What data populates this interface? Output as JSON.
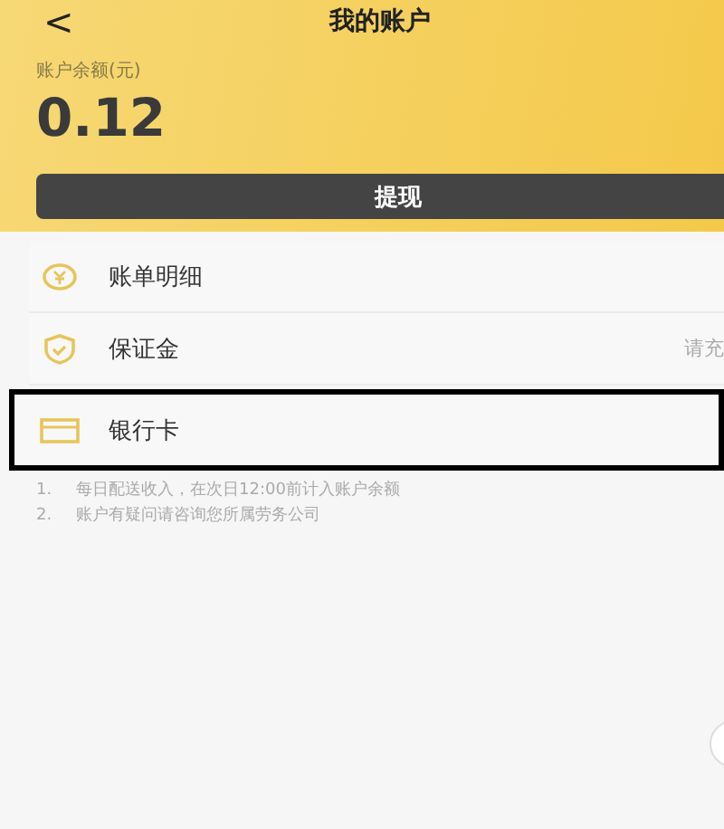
{
  "header": {
    "back": "<",
    "title": "我的账户",
    "balance_label": "账户余额(元)",
    "balance": "0.12",
    "withdraw_button": "提现"
  },
  "menu": [
    {
      "kind": "coin",
      "label": "账单明细",
      "highlighted": false
    },
    {
      "kind": "shield",
      "label": "保证金",
      "value": "请充",
      "highlighted": false
    },
    {
      "kind": "card",
      "label": "银行卡",
      "highlighted": true
    }
  ],
  "notes": [
    {
      "number": "1.",
      "text": "每日配送收入，在次日12:00前计入账户余额"
    },
    {
      "number": "2.",
      "text": "账户有疑问请咨询您所属劳务公司"
    }
  ]
}
